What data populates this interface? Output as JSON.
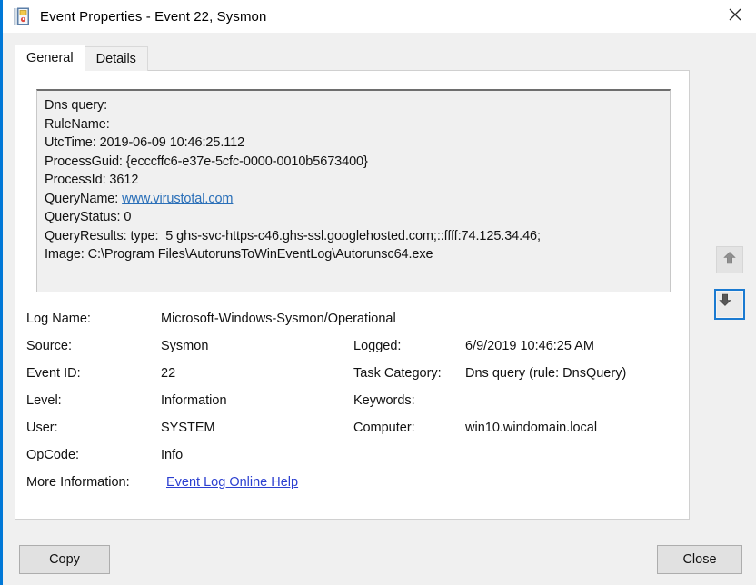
{
  "window": {
    "title": "Event Properties - Event 22, Sysmon",
    "icon": "event-log-icon",
    "close_icon": "close-icon"
  },
  "tabs": [
    {
      "label": "General",
      "selected": true
    },
    {
      "label": "Details",
      "selected": false
    }
  ],
  "description": {
    "lines": [
      "Dns query:",
      "RuleName:",
      "UtcTime: 2019-06-09 10:46:25.112",
      "ProcessGuid: {ecccffc6-e37e-5cfc-0000-0010b5673400}",
      "ProcessId: 3612",
      "QueryName: www.virustotal.com",
      "QueryStatus: 0",
      "QueryResults: type:  5 ghs-svc-https-c46.ghs-ssl.googlehosted.com;::ffff:74.125.34.46;",
      "Image: C:\\Program Files\\AutorunsToWinEventLog\\Autorunsc64.exe"
    ],
    "link_text": "www.virustotal.com",
    "query_name_prefix": "QueryName: "
  },
  "details": {
    "log_name_label": "Log Name:",
    "log_name_value": "Microsoft-Windows-Sysmon/Operational",
    "source_label": "Source:",
    "source_value": "Sysmon",
    "logged_label": "Logged:",
    "logged_value": "6/9/2019 10:46:25 AM",
    "event_id_label": "Event ID:",
    "event_id_value": "22",
    "task_category_label": "Task Category:",
    "task_category_value": "Dns query (rule: DnsQuery)",
    "level_label": "Level:",
    "level_value": "Information",
    "keywords_label": "Keywords:",
    "keywords_value": "",
    "user_label": "User:",
    "user_value": "SYSTEM",
    "computer_label": "Computer:",
    "computer_value": "win10.windomain.local",
    "opcode_label": "OpCode:",
    "opcode_value": "Info",
    "more_info_label": "More Information:",
    "more_info_link": "Event Log Online Help"
  },
  "navigation": {
    "up_icon": "arrow-up-icon",
    "down_icon": "arrow-down-icon"
  },
  "buttons": {
    "copy": "Copy",
    "close": "Close"
  },
  "colors": {
    "accent": "#0078d7",
    "focus_border": "#1a7ad1",
    "hyperlink": "#2b3fd0",
    "url_link": "#2a6fb8",
    "panel_bg": "#ffffff",
    "window_bg": "#f0f0f0"
  }
}
